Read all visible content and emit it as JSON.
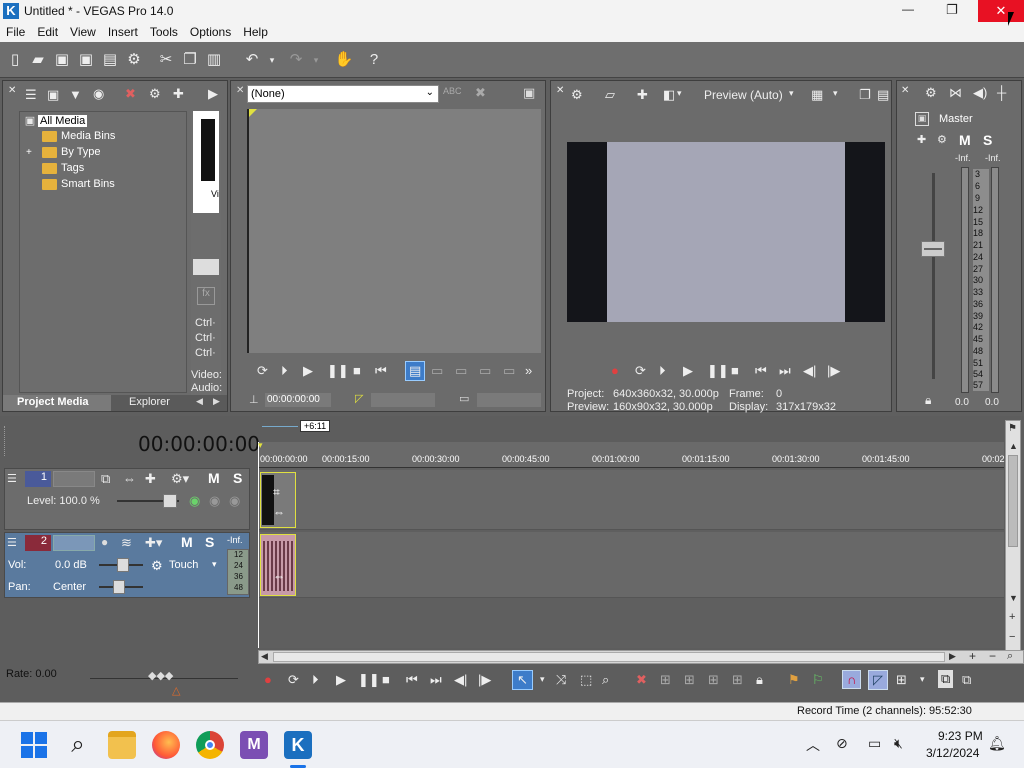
{
  "window": {
    "title": "Untitled * - VEGAS Pro 14.0",
    "minimize": "—",
    "maximize": "❐",
    "close": "✕"
  },
  "menu": [
    "File",
    "Edit",
    "View",
    "Insert",
    "Tools",
    "Options",
    "Help"
  ],
  "project_media": {
    "tree": [
      {
        "label": "All Media",
        "expander": ""
      },
      {
        "label": "Media Bins",
        "expander": ""
      },
      {
        "label": "By Type",
        "expander": "+"
      },
      {
        "label": "Tags",
        "expander": ""
      },
      {
        "label": "Smart Bins",
        "expander": ""
      }
    ],
    "thumb_label": "Vi",
    "ctrl_lines": [
      "Ctrl·",
      "Ctrl·",
      "Ctrl·"
    ],
    "video_label": "Video:",
    "audio_label": "Audio:",
    "tabs": [
      "Project Media",
      "Explorer"
    ]
  },
  "trimmer": {
    "dropdown_value": "(None)",
    "timecode": "00:00:00:00"
  },
  "preview": {
    "mode": "Preview (Auto)",
    "project_label": "Project:",
    "project_value": "640x360x32, 30.000p",
    "preview_label": "Preview:",
    "preview_value": "160x90x32, 30.000p",
    "frame_label": "Frame:",
    "frame_value": "0",
    "display_label": "Display:",
    "display_value": "317x179x32"
  },
  "master": {
    "title": "Master",
    "m": "M",
    "s": "S",
    "inf_left": "-Inf.",
    "inf_right": "-Inf.",
    "scale": [
      "3",
      "6",
      "9",
      "12",
      "15",
      "18",
      "21",
      "24",
      "27",
      "30",
      "33",
      "36",
      "39",
      "42",
      "45",
      "48",
      "51",
      "54",
      "57"
    ],
    "bottom_left": "0.0",
    "bottom_right": "0.0"
  },
  "timeline": {
    "timecode": "00:00:00:00",
    "cursor_marker": "+6:11",
    "ruler": [
      "00:00:00:00",
      "00:00:15:00",
      "00:00:30:00",
      "00:00:45:00",
      "00:01:00:00",
      "00:01:15:00",
      "00:01:30:00",
      "00:01:45:00",
      "00:02"
    ],
    "rate": "Rate: 0.00"
  },
  "tracks": {
    "video": {
      "number": "1",
      "m": "M",
      "s": "S",
      "level": "Level: 100.0 %"
    },
    "audio": {
      "number": "2",
      "m": "M",
      "s": "S",
      "inf": "-Inf.",
      "vol_label": "Vol:",
      "vol_value": "0.0 dB",
      "pan_label": "Pan:",
      "pan_value": "Center",
      "automation": "Touch",
      "mini_scale": [
        "12",
        "24",
        "36",
        "48"
      ]
    }
  },
  "status": {
    "record_time": "Record Time (2 channels): 95:52:30"
  },
  "taskbar": {
    "time": "9:23 PM",
    "date": "3/12/2024"
  },
  "colors": {
    "accent_close": "#e81123",
    "track_yellow": "#e0e040",
    "audio_clip": "#c79aa8"
  }
}
